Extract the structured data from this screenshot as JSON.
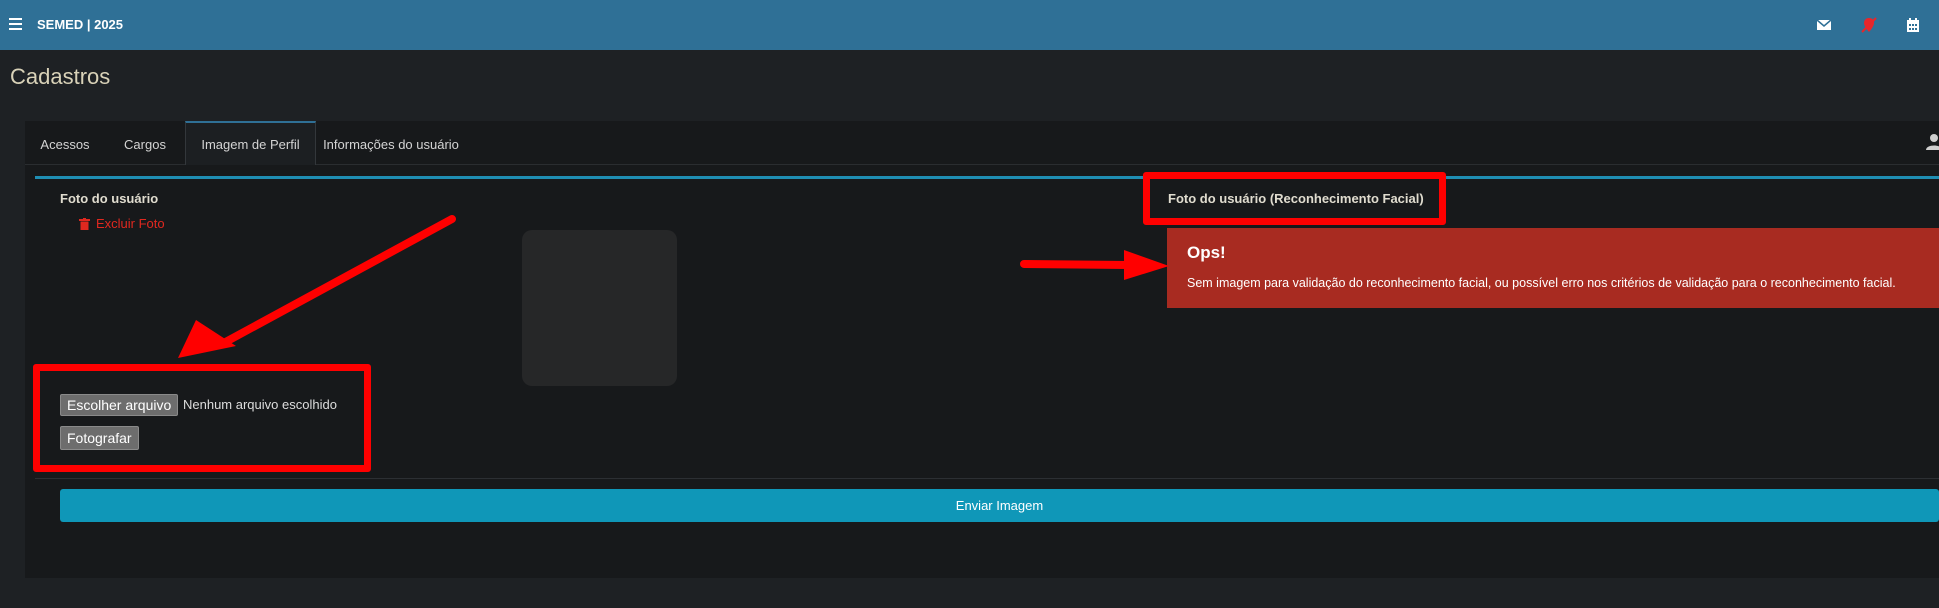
{
  "header": {
    "title": "SEMED | 2025",
    "menu_icon": "hamburger-icon",
    "icons": [
      "envelope-icon",
      "no-location-icon",
      "calendar-icon"
    ],
    "background": "#2f7096"
  },
  "page": {
    "title": "Cadastros"
  },
  "tabs": [
    {
      "label": "Acessos"
    },
    {
      "label": "Cargos"
    },
    {
      "label": "Imagem de Perfil",
      "active": true
    },
    {
      "label": "Informações do usuário"
    }
  ],
  "left": {
    "heading": "Foto do usuário",
    "delete_label": "Excluir Foto",
    "file_button": "Escolher arquivo",
    "file_status": "Nenhum arquivo escolhido",
    "photo_button": "Fotografar"
  },
  "right": {
    "heading": "Foto do usuário (Reconhecimento Facial)",
    "alert_title": "Ops!",
    "alert_message": "Sem imagem para validação do reconhecimento facial, ou possível erro nos critérios de validação para o reconhecimento facial."
  },
  "submit_label": "Enviar Imagem",
  "colors": {
    "accent": "#1f8eb3",
    "alert": "#a82b21",
    "annotation": "#ff0000",
    "submit": "#0f97b8"
  }
}
